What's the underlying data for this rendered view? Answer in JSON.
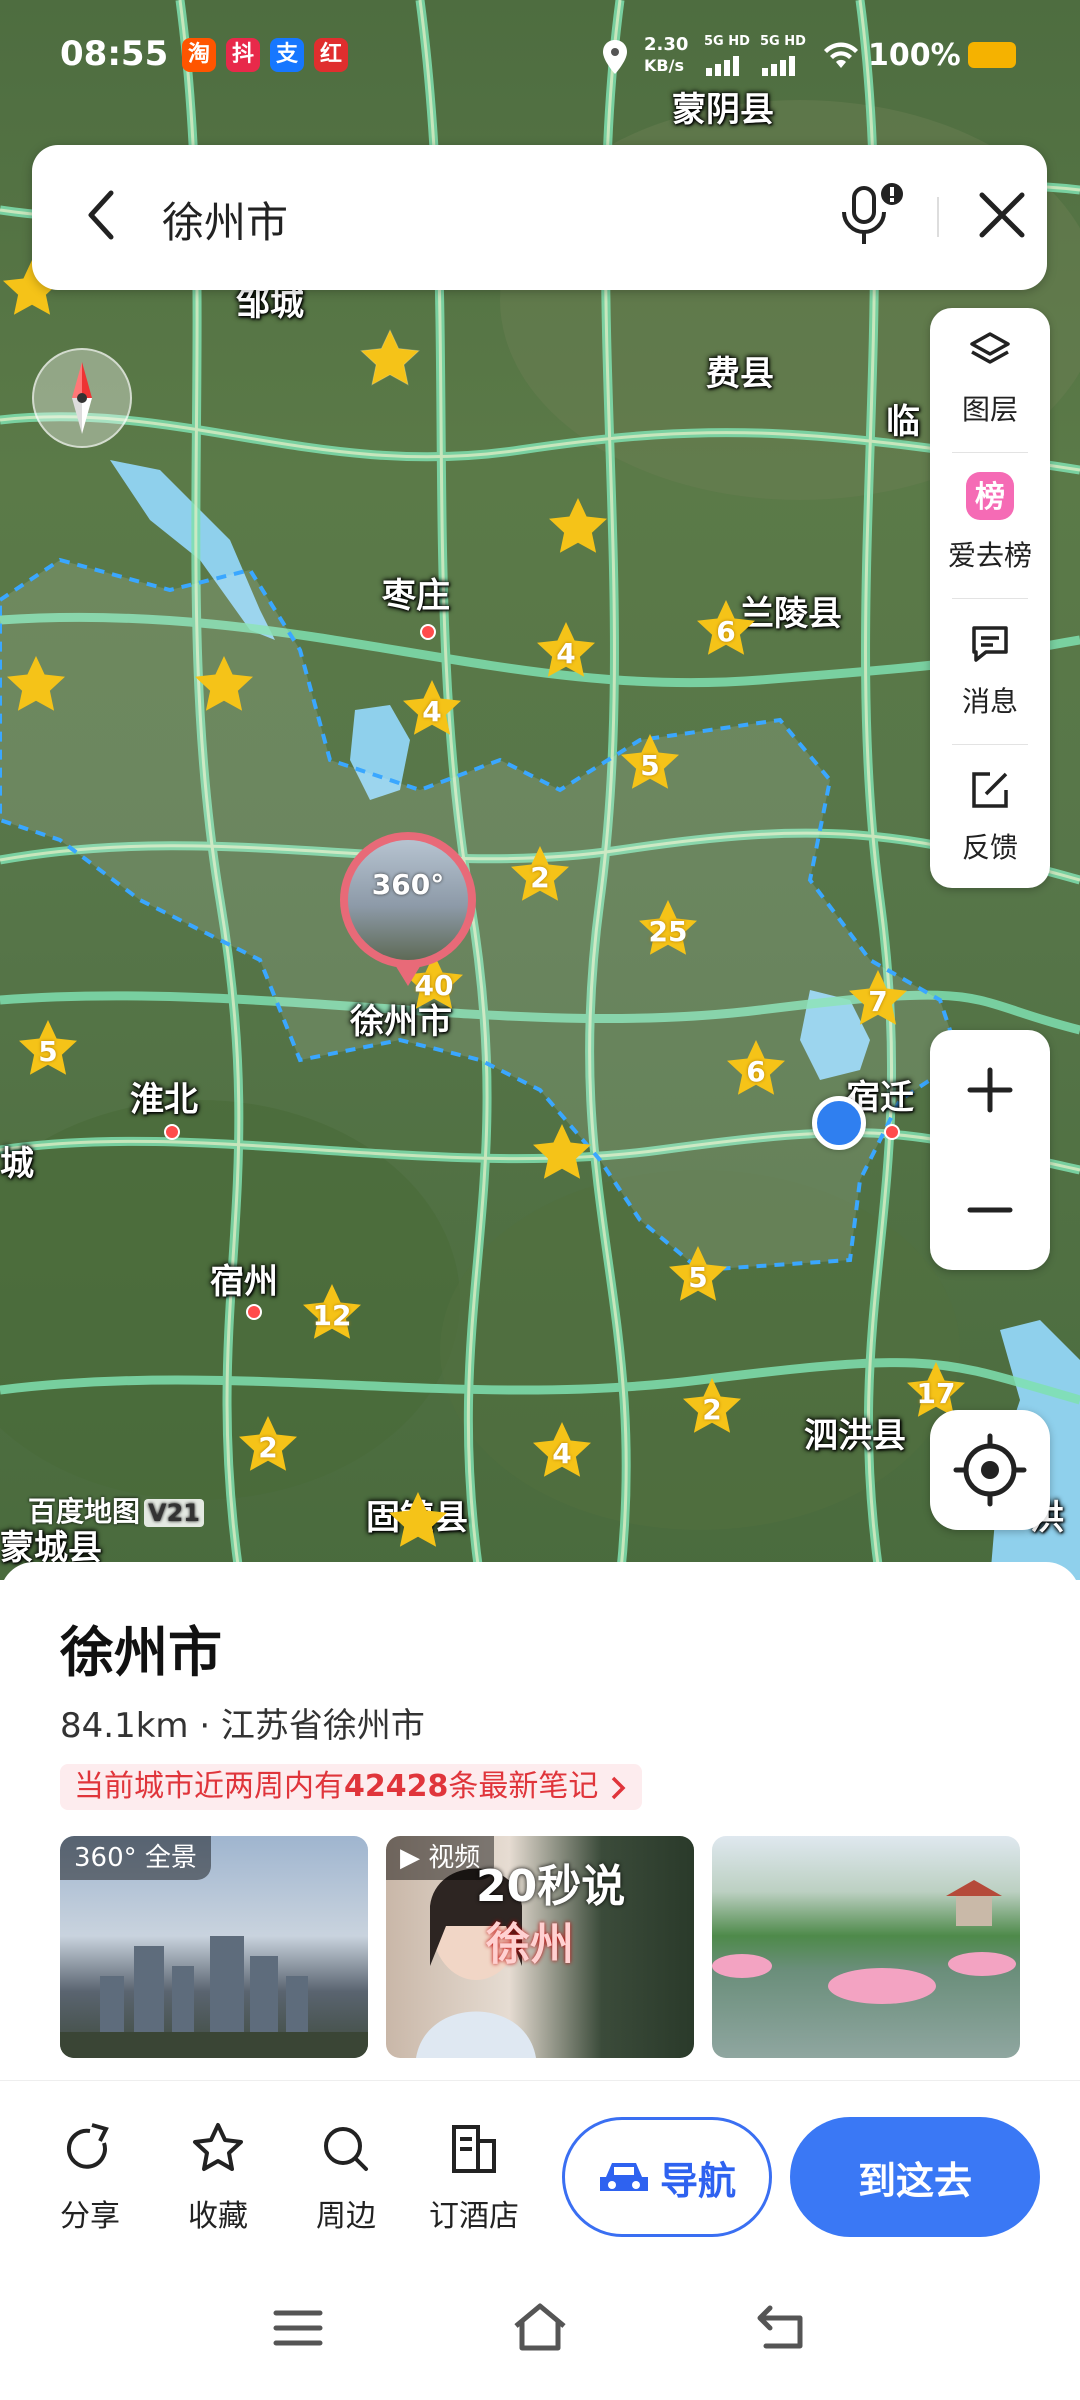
{
  "status": {
    "time": "08:55",
    "apps": [
      "淘",
      "抖",
      "支",
      "红"
    ],
    "net_speed_value": "2.30",
    "net_speed_unit": "KB/s",
    "signal": [
      "5G HD",
      "5G HD"
    ],
    "battery": "100%"
  },
  "search": {
    "query": "徐州市"
  },
  "map": {
    "places": [
      "蒙阴县",
      "费县",
      "枣庄",
      "临",
      "兰陵县",
      "徐州市",
      "淮北",
      "宿迁",
      "宿州",
      "泗洪县",
      "固镇县",
      "蒙城县",
      "城",
      "洪",
      "邹城"
    ],
    "clusters": [
      "4",
      "4",
      "6",
      "5",
      "2",
      "25",
      "40",
      "7",
      "6",
      "5",
      "12",
      "5",
      "2",
      "4",
      "2",
      "17"
    ],
    "pano_label": "360°",
    "watermark": "百度地图",
    "watermark_version": "V21"
  },
  "tools": [
    {
      "label": "图层",
      "icon": "layers-icon"
    },
    {
      "label": "爱去榜",
      "icon": "ranking-badge-icon"
    },
    {
      "label": "消息",
      "icon": "message-icon"
    },
    {
      "label": "反馈",
      "icon": "feedback-icon"
    }
  ],
  "place": {
    "name": "徐州市",
    "distance_region": "84.1km · 江苏省徐州市",
    "notes_prefix": "当前城市近两周内有",
    "notes_count": "42428",
    "notes_suffix": "条最新笔记",
    "photos": [
      {
        "tag": "全景",
        "tag_prefix": "360°",
        "kind": "panorama"
      },
      {
        "tag": "视频",
        "kind": "video",
        "overlay_line1": "20秒说",
        "overlay_line2": "徐州"
      },
      {
        "tag": "",
        "kind": "photo"
      }
    ]
  },
  "actions": {
    "share": "分享",
    "favorite": "收藏",
    "nearby": "周边",
    "hotel": "订酒店",
    "navigate": "导航",
    "go_here": "到这去"
  },
  "colors": {
    "accent": "#3a78f5",
    "notes_red": "#e0353b",
    "star": "#f5c318"
  }
}
